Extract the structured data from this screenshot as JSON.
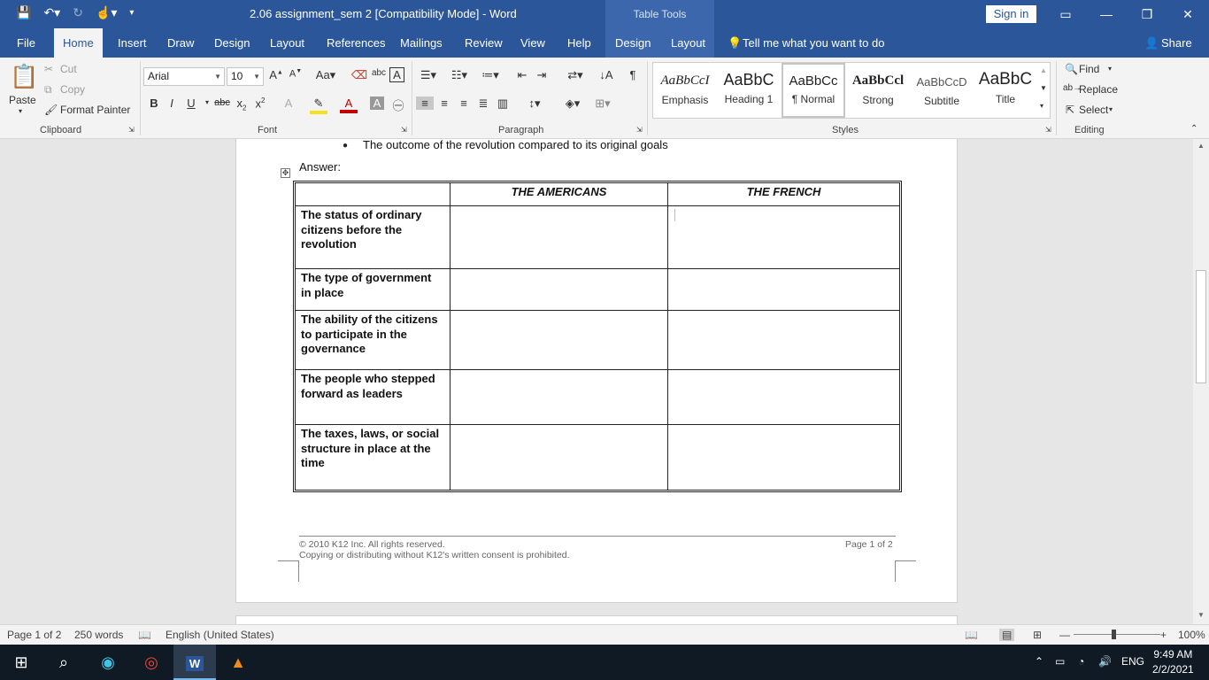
{
  "titlebar": {
    "title": "2.06 assignment_sem 2 [Compatibility Mode]  -  Word",
    "table_tools": "Table Tools",
    "signin": "Sign in"
  },
  "menu": {
    "tabs": [
      "File",
      "Home",
      "Insert",
      "Draw",
      "Design",
      "Layout",
      "References",
      "Mailings",
      "Review",
      "View",
      "Help",
      "Design",
      "Layout"
    ],
    "tell_me": "Tell me what you want to do",
    "share": "Share"
  },
  "ribbon": {
    "clipboard": {
      "paste": "Paste",
      "cut": "Cut",
      "copy": "Copy",
      "format_painter": "Format Painter",
      "label": "Clipboard"
    },
    "font": {
      "name": "Arial",
      "size": "10",
      "label": "Font"
    },
    "paragraph": {
      "label": "Paragraph"
    },
    "styles": {
      "label": "Styles",
      "items": [
        {
          "sample": "AaBbCcI",
          "label": "Emphasis"
        },
        {
          "sample": "AaBbC",
          "label": "Heading 1"
        },
        {
          "sample": "AaBbCc",
          "label": "¶ Normal"
        },
        {
          "sample": "AaBbCcl",
          "label": "Strong"
        },
        {
          "sample": "AaBbCcD",
          "label": "Subtitle"
        },
        {
          "sample": "AaBbC",
          "label": "Title"
        }
      ]
    },
    "editing": {
      "find": "Find",
      "replace": "Replace",
      "select": "Select",
      "label": "Editing"
    }
  },
  "document": {
    "bullet": "The outcome of the revolution compared to its original goals",
    "answer": "Answer:",
    "table": {
      "headers": [
        "",
        "THE AMERICANS",
        "THE FRENCH"
      ],
      "rows": [
        "The status of ordinary citizens before the revolution",
        "The type of government in place",
        "The ability of the citizens to participate in the governance",
        "The people who stepped forward as leaders",
        "The taxes, laws, or social structure in place at the time"
      ]
    },
    "footer": {
      "copyright": "© 2010 K12 Inc. All rights reserved.",
      "notice": "Copying or distributing without K12's written consent is prohibited.",
      "page": "Page 1 of 2"
    }
  },
  "statusbar": {
    "page": "Page 1 of 2",
    "words": "250 words",
    "language": "English (United States)",
    "zoom": "100%"
  },
  "taskbar": {
    "lang": "ENG",
    "time": "9:49 AM",
    "date": "2/2/2021"
  },
  "colors": {
    "word_blue": "#2b579a",
    "taskbar": "#101a24"
  }
}
